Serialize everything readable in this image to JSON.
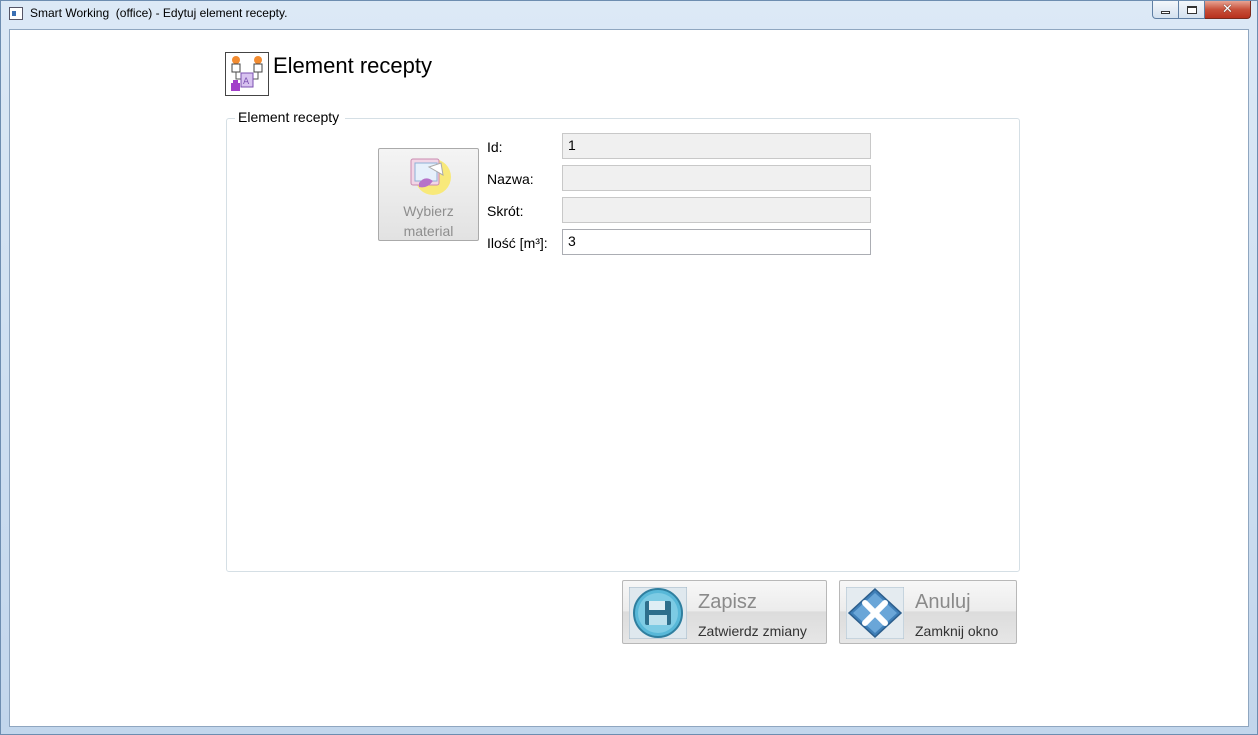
{
  "window": {
    "title": "Smart Working  (office) - Edytuj element recepty."
  },
  "header": {
    "title": "Element recepty",
    "icon": "recipe-element-icon"
  },
  "group": {
    "legend": "Element recepty"
  },
  "select_material_button": {
    "line1": "Wybierz",
    "line2": "material",
    "icon": "material-box-icon"
  },
  "fields": {
    "id": {
      "label": "Id:",
      "value": "1"
    },
    "name": {
      "label": "Nazwa:",
      "value": ""
    },
    "short": {
      "label": "Skrót:",
      "value": ""
    },
    "quantity": {
      "label": "Ilość [m³]:",
      "value": "3"
    }
  },
  "actions": {
    "save": {
      "label": "Zapisz",
      "sublabel": "Zatwierdz zmiany",
      "icon": "floppy-disk-icon"
    },
    "cancel": {
      "label": "Anuluj",
      "sublabel": "Zamknij okno",
      "icon": "close-x-icon"
    }
  }
}
